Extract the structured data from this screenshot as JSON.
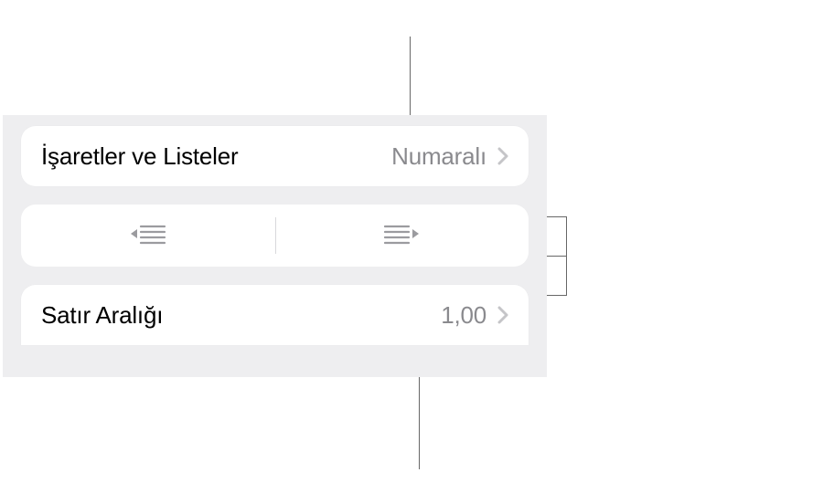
{
  "bullets": {
    "label": "İşaretler ve Listeler",
    "value": "Numaralı"
  },
  "spacing": {
    "label": "Satır Aralığı",
    "value": "1,00"
  }
}
